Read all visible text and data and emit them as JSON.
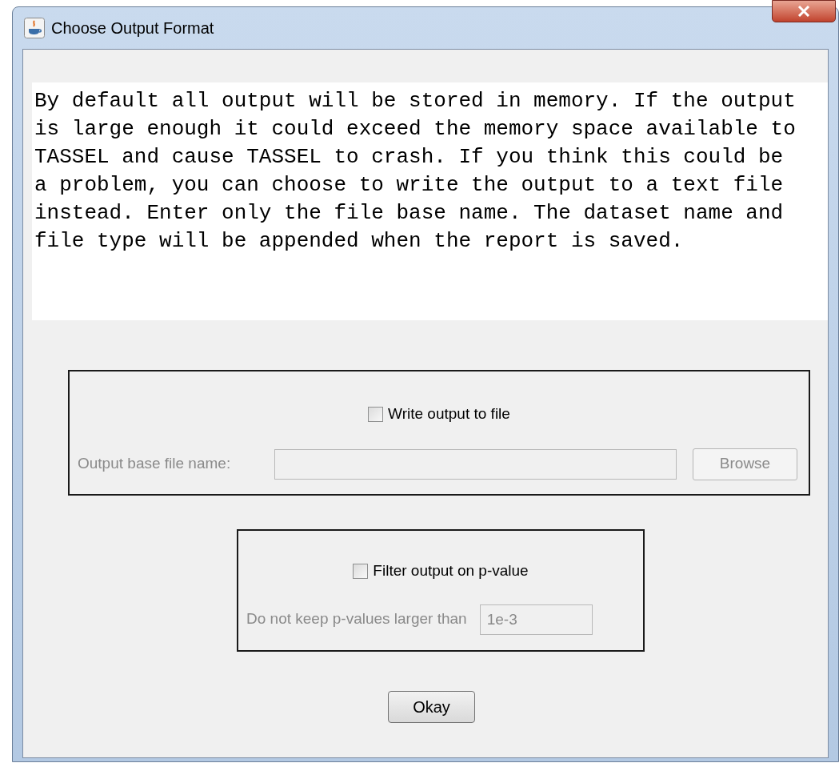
{
  "window": {
    "title": "Choose Output Format"
  },
  "message": "By default all output will be stored in memory. If the output\nis large enough it could exceed the memory space available to\nTASSEL and cause TASSEL to crash. If you think this could be\na problem, you can choose to write the output to a text file\ninstead. Enter only the file base name. The dataset name and\nfile type will be appended when the report is saved.",
  "file_output": {
    "checkbox": {
      "label": "Write output to file",
      "checked": false
    },
    "field_label": "Output base file name:",
    "field": {
      "disabled": true
    },
    "browse_button": {
      "label": "Browse",
      "disabled": true
    }
  },
  "pvalue_filter": {
    "checkbox": {
      "label": "Filter output on p-value",
      "checked": false
    },
    "field_label": "Do not keep p-values larger than",
    "field": {
      "value": "1e-3",
      "disabled": true
    }
  },
  "ok_button": {
    "label": "Okay"
  }
}
